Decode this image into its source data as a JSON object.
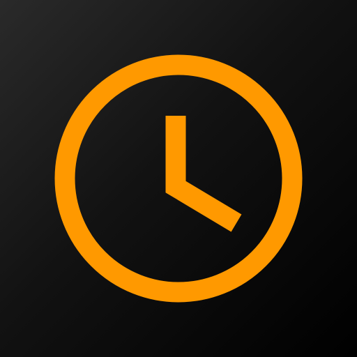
{
  "icon": {
    "name": "clock-icon",
    "accent_color": "#FF9900",
    "background_top_left": "#2A2A2A",
    "background_bottom_right": "#000000"
  }
}
